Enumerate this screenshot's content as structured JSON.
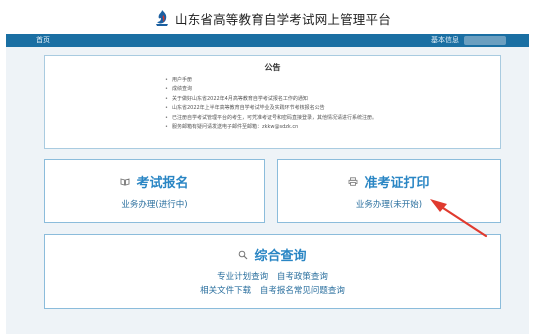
{
  "header": {
    "title": "山东省高等教育自学考试网上管理平台",
    "logo_icon": "flame-logo-icon"
  },
  "nav": {
    "home": "首页",
    "user_info": "基本信息"
  },
  "notice": {
    "title": "公告",
    "items": [
      "用户手册",
      "成绩查询",
      "关于做好山东省2022年4月高等教育自学考试报名工作的通知",
      "山东省2022年上半年高等教育自学考试毕业及实践环节考核报名公告",
      "已注册自学考试管理平台的考生，可凭准考证号和密码直接登录，其他情况请进行系统注册。",
      "服务邮箱有疑问请发送电子邮件至邮箱：zkkw@sdzk.cn"
    ]
  },
  "cards": {
    "exam": {
      "title": "考试报名",
      "sub": "业务办理(进行中)",
      "icon": "book-icon"
    },
    "cert": {
      "title": "准考证打印",
      "sub": "业务办理(未开始)",
      "icon": "printer-icon"
    },
    "query": {
      "title": "综合查询",
      "icon": "search-icon",
      "links_row1": [
        "专业计划查询",
        "自考政策查询"
      ],
      "links_row2": [
        "相关文件下载",
        "自考报名常见问题查询"
      ]
    }
  },
  "colors": {
    "nav_bar": "#1a6fa3",
    "card_title": "#2a86c4",
    "card_border": "#8bbcdb",
    "annotation_arrow": "#e03a2e"
  }
}
